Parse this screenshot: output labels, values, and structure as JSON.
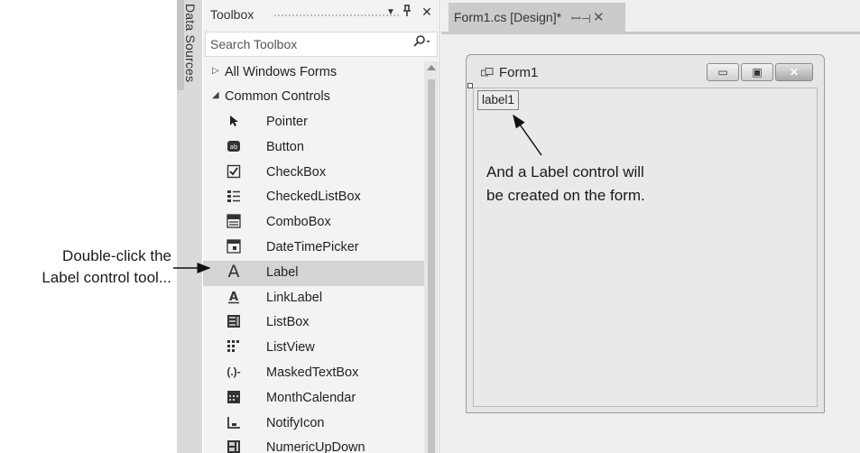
{
  "annotations": {
    "left_line1": "Double-click the",
    "left_line2": "Label control tool...",
    "right_line1": "And a Label control will",
    "right_line2": "be created on the form."
  },
  "data_sources_tab": "Data Sources",
  "toolbox": {
    "title": "Toolbox",
    "dropdown_icon": "▼",
    "pin_icon": "ꟷ",
    "close_icon": "✕",
    "search_placeholder": "Search Toolbox",
    "groups": [
      {
        "label": "All Windows Forms",
        "expanded": false
      },
      {
        "label": "Common Controls",
        "expanded": true
      }
    ],
    "tools": [
      {
        "label": "Pointer",
        "icon": "pointer-icon",
        "selected": false
      },
      {
        "label": "Button",
        "icon": "button-icon",
        "selected": false
      },
      {
        "label": "CheckBox",
        "icon": "checkbox-icon",
        "selected": false
      },
      {
        "label": "CheckedListBox",
        "icon": "checkedlistbox-icon",
        "selected": false
      },
      {
        "label": "ComboBox",
        "icon": "combobox-icon",
        "selected": false
      },
      {
        "label": "DateTimePicker",
        "icon": "datetimepicker-icon",
        "selected": false
      },
      {
        "label": "Label",
        "icon": "label-icon",
        "selected": true
      },
      {
        "label": "LinkLabel",
        "icon": "linklabel-icon",
        "selected": false
      },
      {
        "label": "ListBox",
        "icon": "listbox-icon",
        "selected": false
      },
      {
        "label": "ListView",
        "icon": "listview-icon",
        "selected": false
      },
      {
        "label": "MaskedTextBox",
        "icon": "maskedtextbox-icon",
        "selected": false
      },
      {
        "label": "MonthCalendar",
        "icon": "monthcalendar-icon",
        "selected": false
      },
      {
        "label": "NotifyIcon",
        "icon": "notifyicon-icon",
        "selected": false
      },
      {
        "label": "NumericUpDown",
        "icon": "numericupdown-icon",
        "selected": false
      }
    ]
  },
  "designer": {
    "tab_label": "Form1.cs [Design]*",
    "form_title": "Form1",
    "label_control": "label1"
  },
  "colors": {
    "selected_row": "#d4d4d4",
    "panel_bg": "#f3f3f3",
    "designer_bg": "#efefef",
    "tab_bg": "#cbcbcb"
  }
}
